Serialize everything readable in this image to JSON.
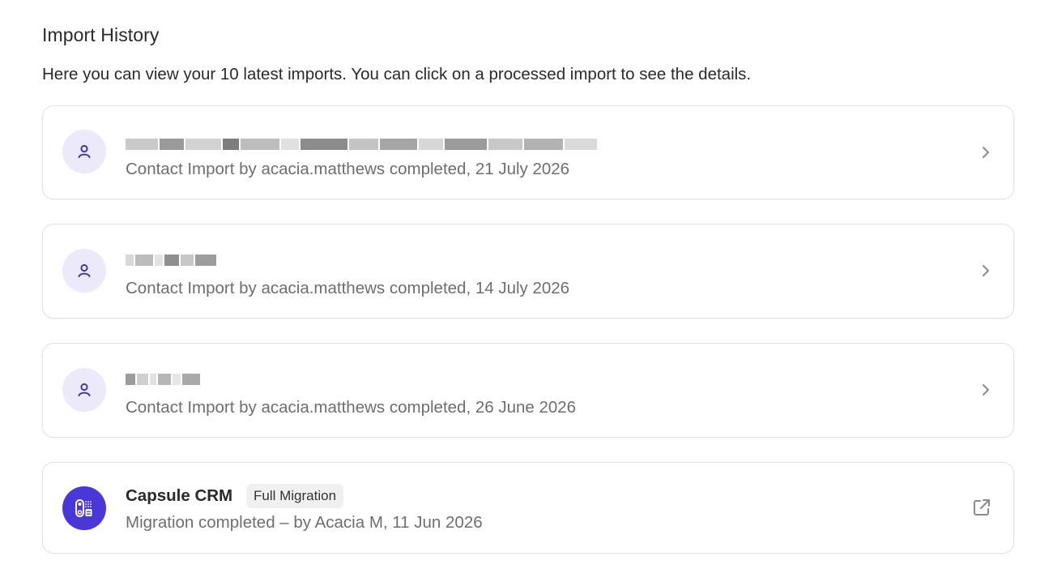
{
  "page": {
    "title": "Import History",
    "subtitle": "Here you can view your 10 latest imports. You can click on a processed import to see the details."
  },
  "imports": [
    {
      "meta": "Contact Import by acacia.matthews completed, 21 July 2026",
      "icon": "person-icon",
      "action_icon": "chevron-right-icon"
    },
    {
      "meta": "Contact Import by acacia.matthews completed, 14 July 2026",
      "icon": "person-icon",
      "action_icon": "chevron-right-icon"
    },
    {
      "meta": "Contact Import by acacia.matthews completed, 26 June 2026",
      "icon": "person-icon",
      "action_icon": "chevron-right-icon"
    }
  ],
  "migration": {
    "name": "Capsule CRM",
    "badge": "Full Migration",
    "meta": "Migration completed – by Acacia M, 11 Jun 2026",
    "icon": "capsule-crm-logo-icon",
    "action_icon": "external-link-icon"
  },
  "colors": {
    "avatar_bg": "#ece9fb",
    "avatar_fg": "#3f3aa8",
    "brand": "#4a37d8",
    "muted_text": "#6e6e6e",
    "border": "#e2e2e2"
  }
}
